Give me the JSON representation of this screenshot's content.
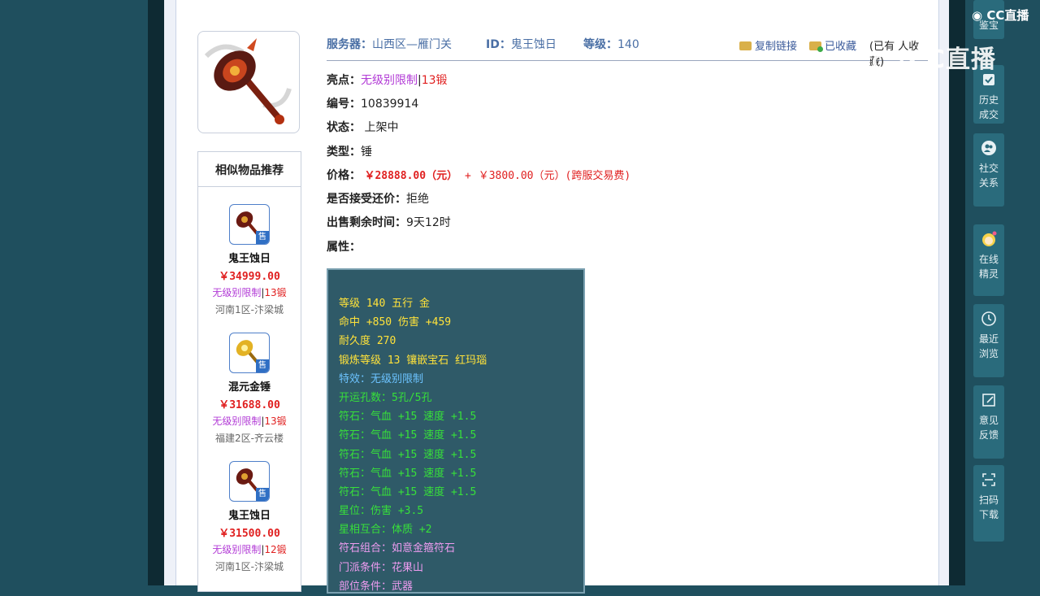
{
  "header": {
    "server_label": "服务器：",
    "server_value": "山西区—雁门关",
    "id_label": "ID：",
    "id_value": "鬼王蚀日",
    "level_label": "等级：",
    "level_value": "140",
    "copy_link": "复制链接",
    "favorited": "已收藏",
    "fav_note": "(已有  人收藏)"
  },
  "item": {
    "highlight_label": "亮点：",
    "highlight_tag1": "无级别限制",
    "highlight_sep": "|",
    "highlight_tag2": "13锻",
    "number_label": "编号：",
    "number_value": "10839914",
    "status_label": "状态：",
    "status_value": "上架中",
    "type_label": "类型：",
    "type_value": "锤",
    "price_label": "价格：",
    "price_value": "￥28888.00（元）",
    "price_plus": "+",
    "price_fee": "￥3800.00（元）(跨服交易费)",
    "bargain_label": "是否接受还价：",
    "bargain_value": "拒绝",
    "remaining_label": "出售剩余时间：",
    "remaining_value": "9天12时",
    "attr_label": "属性："
  },
  "attributes": [
    {
      "text": "等级 140 五行 金",
      "color": "yellow"
    },
    {
      "text": "命中 +850 伤害 +459",
      "color": "yellow"
    },
    {
      "text": "耐久度 270",
      "color": "yellow"
    },
    {
      "text": "锻炼等级 13 镶嵌宝石 红玛瑙",
      "color": "yellow"
    },
    {
      "text": "特效：无级别限制",
      "color": "blue"
    },
    {
      "text": "开运孔数：5孔/5孔",
      "color": "green"
    },
    {
      "text": "符石：气血 +15 速度 +1.5",
      "color": "green"
    },
    {
      "text": "符石：气血 +15 速度 +1.5",
      "color": "green"
    },
    {
      "text": "符石：气血 +15 速度 +1.5",
      "color": "green"
    },
    {
      "text": "符石：气血 +15 速度 +1.5",
      "color": "green"
    },
    {
      "text": "符石：气血 +15 速度 +1.5",
      "color": "green"
    },
    {
      "text": "星位：伤害 +3.5",
      "color": "green"
    },
    {
      "text": "星相互合：体质 +2",
      "color": "green"
    },
    {
      "text": "符石组合：如意金箍符石",
      "color": "pink"
    },
    {
      "text": "门派条件：花果山",
      "color": "pink"
    },
    {
      "text": "部位条件：武器",
      "color": "pink"
    }
  ],
  "similar": {
    "title": "相似物品推荐",
    "sell_tag": "售",
    "items": [
      {
        "name": "鬼王蚀日",
        "price": "￥34999.00",
        "tag1": "无级别限制",
        "sep": "|",
        "tag2": "13锻",
        "server": "河南1区-汴梁城"
      },
      {
        "name": "混元金锤",
        "price": "￥31688.00",
        "tag1": "无级别限制",
        "sep": "|",
        "tag2": "13锻",
        "server": "福建2区-齐云楼"
      },
      {
        "name": "鬼王蚀日",
        "price": "￥31500.00",
        "tag1": "无级别限制",
        "sep": "|",
        "tag2": "12锻",
        "server": "河南1区-汴梁城"
      }
    ]
  },
  "sidebar": {
    "items": [
      {
        "label1": "鉴宝",
        "label2": ""
      },
      {
        "label1": "历史",
        "label2": "成交"
      },
      {
        "label1": "社交",
        "label2": "关系"
      },
      {
        "label1": "在线",
        "label2": "精灵"
      },
      {
        "label1": "最近",
        "label2": "浏览"
      },
      {
        "label1": "意见",
        "label2": "反馈"
      },
      {
        "label1": "扫码",
        "label2": "下载"
      }
    ]
  },
  "watermark": {
    "small": "CC直播",
    "large": "CC直播"
  },
  "colors": {
    "accent": "#4a6fa5",
    "price_red": "#e02020",
    "tag_purple": "#b23bd6",
    "attr_bg": "#2f5a68"
  }
}
